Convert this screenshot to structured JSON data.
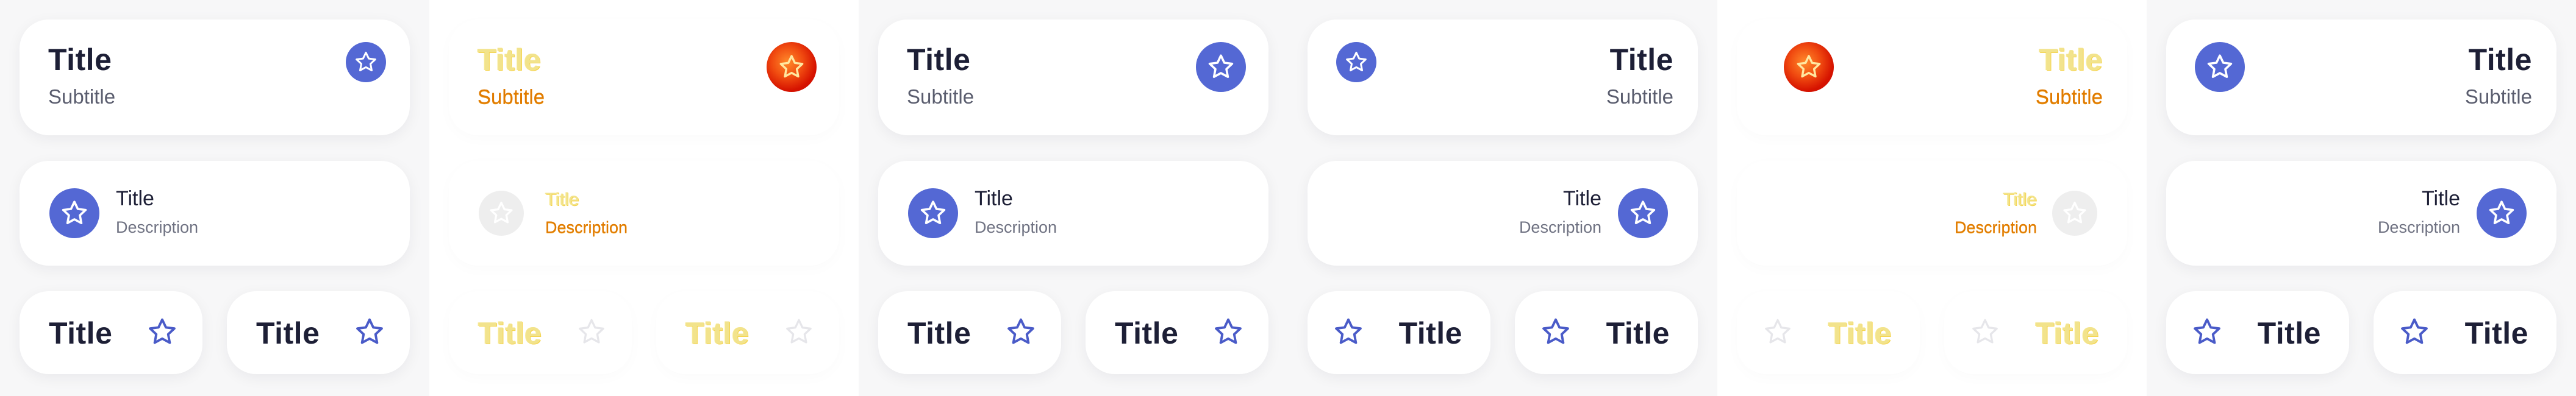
{
  "colors": {
    "accent": "#5468d4",
    "title": "#1d1f36",
    "subtitle": "#5a5d6e",
    "description": "#6f7282",
    "glitch_title": "#f2e38c",
    "glitch_subtitle": "#e07a00",
    "glitch_badge": "#d61300"
  },
  "panels": [
    {
      "header": {
        "title": "Title",
        "subtitle": "Subtitle",
        "icon": "star-icon"
      },
      "list": {
        "title": "Title",
        "description": "Description",
        "icon": "star-icon"
      },
      "chips": [
        {
          "title": "Title",
          "icon": "star-icon"
        },
        {
          "title": "Title",
          "icon": "star-icon"
        }
      ]
    },
    {
      "header": {
        "title": "Title",
        "subtitle": "Subtitle",
        "icon": "star-icon"
      },
      "list": {
        "title": "Title",
        "description": "Description",
        "icon": "star-icon"
      },
      "chips": [
        {
          "title": "Title",
          "icon": "star-icon"
        },
        {
          "title": "Title",
          "icon": "star-icon"
        }
      ]
    },
    {
      "header": {
        "title": "Title",
        "subtitle": "Subtitle",
        "icon": "star-icon"
      },
      "list": {
        "title": "Title",
        "description": "Description",
        "icon": "star-icon"
      },
      "chips": [
        {
          "title": "Title",
          "icon": "star-icon"
        },
        {
          "title": "Title",
          "icon": "star-icon"
        }
      ]
    },
    {
      "header": {
        "title": "Title",
        "subtitle": "Subtitle",
        "icon": "star-icon"
      },
      "list": {
        "title": "Title",
        "description": "Description",
        "icon": "star-icon"
      },
      "chips": [
        {
          "title": "Title",
          "icon": "star-icon"
        },
        {
          "title": "Title",
          "icon": "star-icon"
        }
      ]
    },
    {
      "header": {
        "title": "Title",
        "subtitle": "Subtitle",
        "icon": "star-icon"
      },
      "list": {
        "title": "Title",
        "description": "Description",
        "icon": "star-icon"
      },
      "chips": [
        {
          "title": "Title",
          "icon": "star-icon"
        },
        {
          "title": "Title",
          "icon": "star-icon"
        }
      ]
    },
    {
      "header": {
        "title": "Title",
        "subtitle": "Subtitle",
        "icon": "star-icon"
      },
      "list": {
        "title": "Title",
        "description": "Description",
        "icon": "star-icon"
      },
      "chips": [
        {
          "title": "Title",
          "icon": "star-icon"
        },
        {
          "title": "Title",
          "icon": "star-icon"
        }
      ]
    }
  ]
}
